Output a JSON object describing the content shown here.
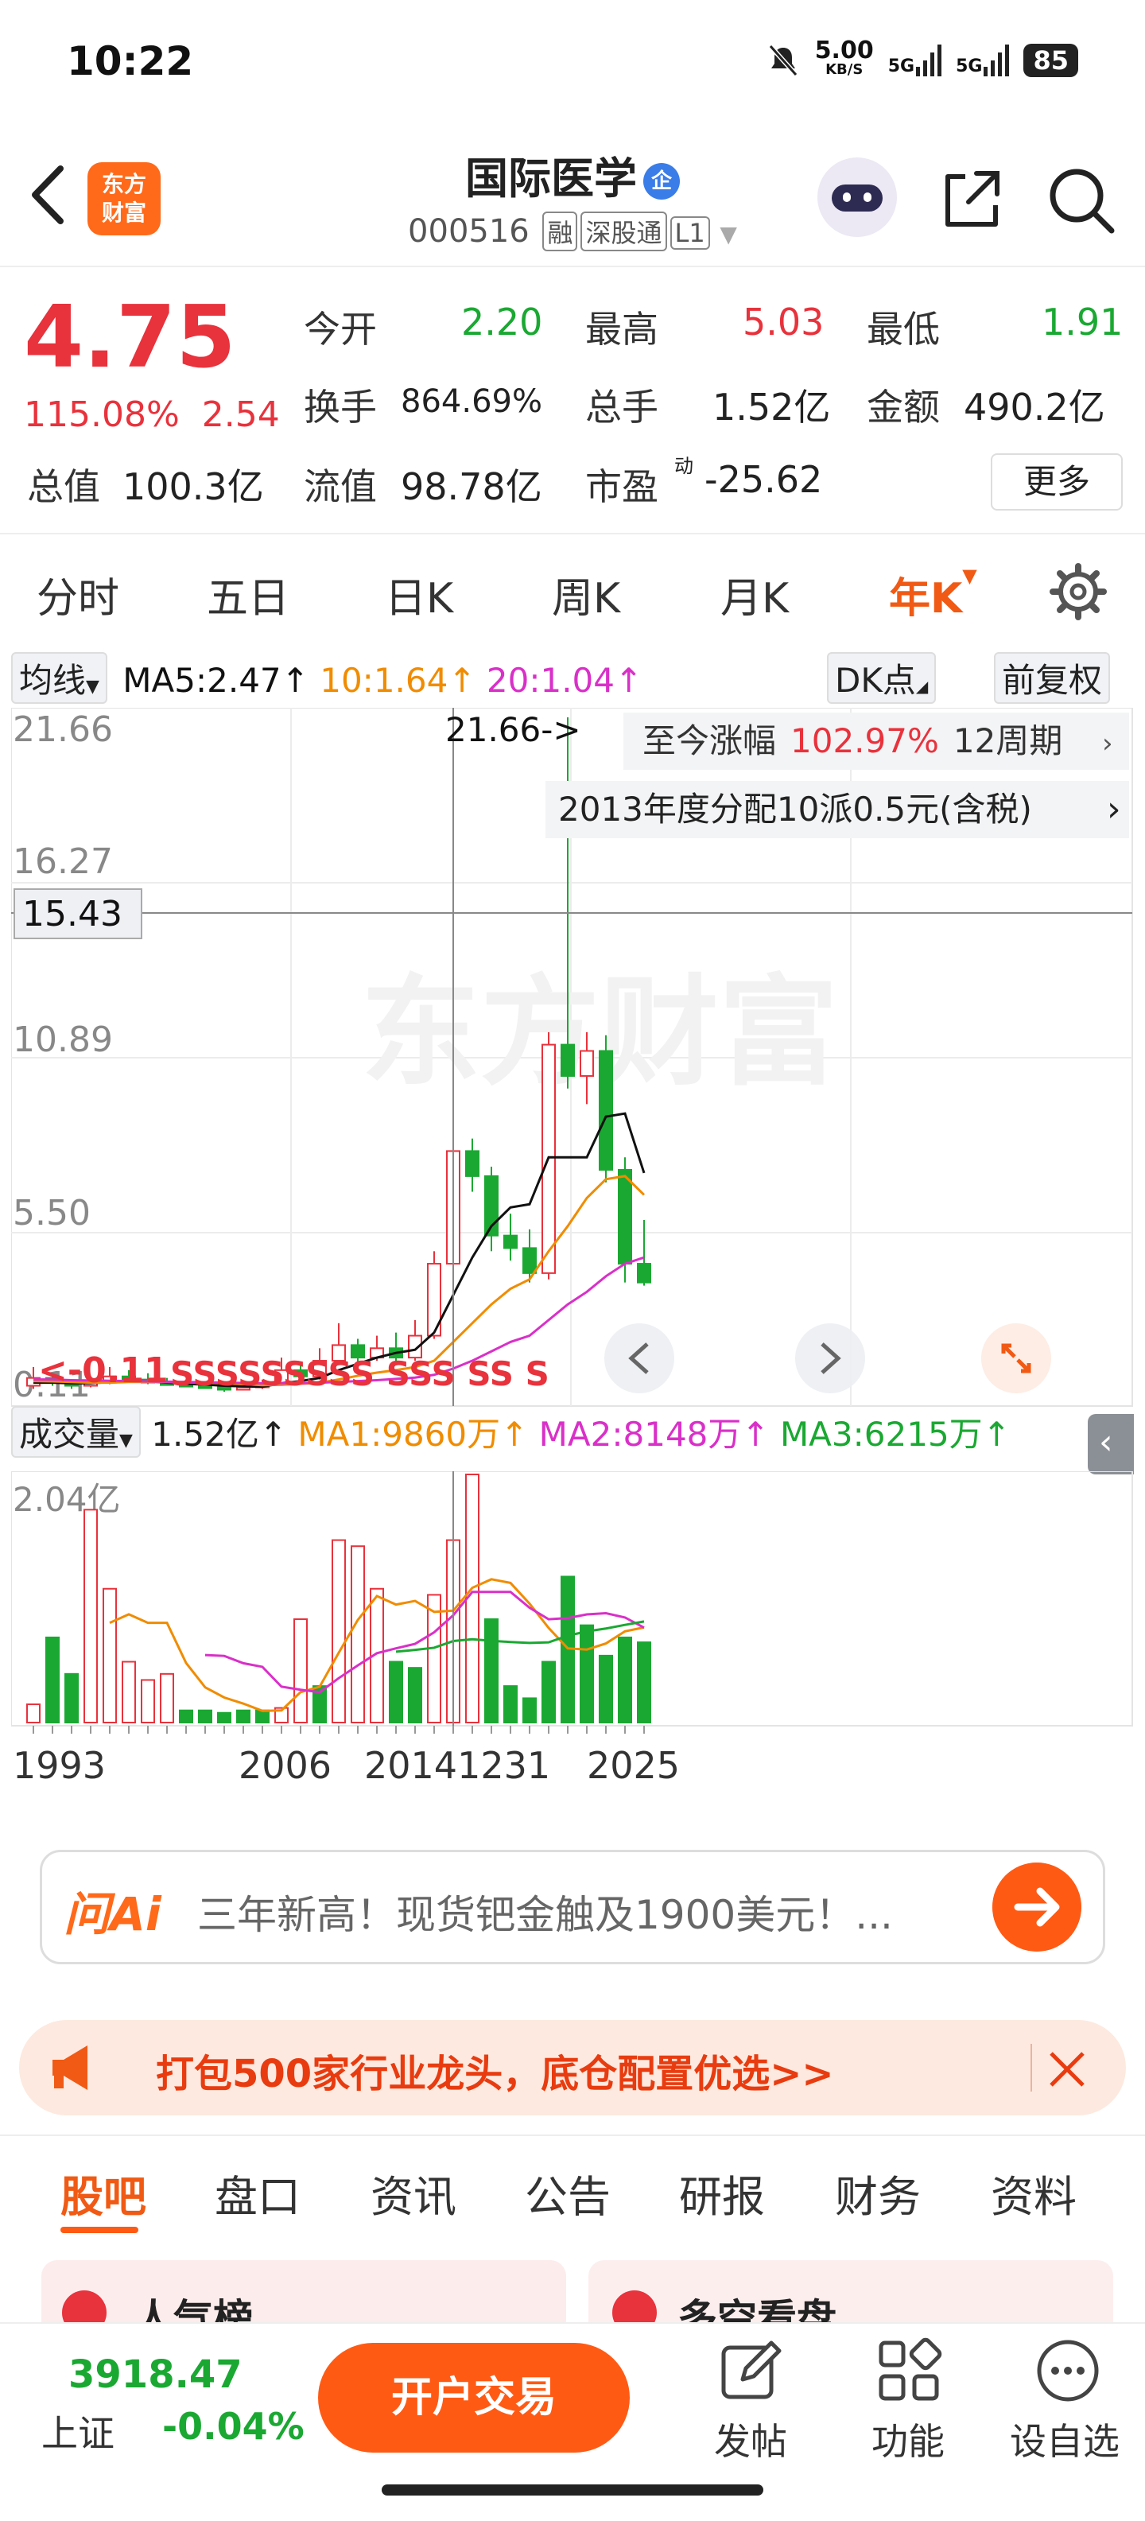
{
  "status_bar": {
    "time": "10:22",
    "net_speed": "5.00",
    "net_unit": "KB/S",
    "signal1": "5G",
    "signal2": "5G",
    "battery": "85"
  },
  "header": {
    "logo_text_line1": "东方",
    "logo_text_line2": "财富",
    "stock_name": "国际医学",
    "stock_badge": "企",
    "stock_code": "000516",
    "tags": [
      "融",
      "深股通",
      "L1"
    ]
  },
  "quote": {
    "price": "4.75",
    "change_pct": "115.08%",
    "change_amt": "2.54",
    "fields": {
      "open_label": "今开",
      "open": "2.20",
      "high_label": "最高",
      "high": "5.03",
      "low_label": "最低",
      "low": "1.91",
      "turnover_label": "换手",
      "turnover": "864.69%",
      "volume_label": "总手",
      "volume": "1.52亿",
      "amount_label": "金额",
      "amount": "490.2亿",
      "mcap_label": "总值",
      "mcap": "100.3亿",
      "float_label": "流值",
      "float": "98.78亿",
      "pe_label": "市盈",
      "pe_sup": "动",
      "pe": "-25.62"
    },
    "more_label": "更多"
  },
  "period_tabs": [
    "分时",
    "五日",
    "日K",
    "周K",
    "月K",
    "年K"
  ],
  "active_period": "年K",
  "chart_toolbar": {
    "ma_select": "均线",
    "ma5": "MA5:2.47↑",
    "ma10": "10:1.64↑",
    "ma20": "20:1.04↑",
    "dk_label": "DK点",
    "adjust_label": "前复权"
  },
  "chart_labels": {
    "y_ticks": [
      "21.66",
      "16.27",
      "10.89",
      "5.50",
      "0.11"
    ],
    "crosshair_price": "15.43",
    "high_marker": "21.66->",
    "low_marker": "<-0.11",
    "gain_prefix": "至今涨幅",
    "gain_value": "102.97%",
    "gain_period": "12周期",
    "dividend_note": "2013年度分配10派0.5元(含税)",
    "watermark": "东方财富",
    "signals": "SSSSSSSSS SSS SS S"
  },
  "volume_toolbar": {
    "select": "成交量",
    "vol": "1.52亿↑",
    "ma1": "MA1:9860万↑",
    "ma2": "MA2:8148万↑",
    "ma3": "MA3:6215万↑",
    "y_max": "2.04亿"
  },
  "x_axis": [
    "1993",
    "2006",
    "20141231",
    "2025"
  ],
  "colors": {
    "up": "#e8323c",
    "down": "#1aa832",
    "ma5": "#111111",
    "ma10": "#f08c00",
    "ma20": "#d930c8",
    "accent": "#ff5a14"
  },
  "chart_data": {
    "type": "candlestick",
    "period": "yearly",
    "x_range": [
      "1993",
      "2025"
    ],
    "ylim": [
      0.11,
      21.66
    ],
    "candles": [
      {
        "o": 0.3,
        "c": 0.55,
        "h": 0.9,
        "l": 0.2
      },
      {
        "o": 0.55,
        "c": 0.4,
        "h": 0.7,
        "l": 0.3
      },
      {
        "o": 0.4,
        "c": 0.3,
        "h": 0.5,
        "l": 0.2
      },
      {
        "o": 0.3,
        "c": 0.4,
        "h": 0.6,
        "l": 0.25
      },
      {
        "o": 0.4,
        "c": 0.6,
        "h": 0.9,
        "l": 0.35
      },
      {
        "o": 0.6,
        "c": 0.5,
        "h": 0.8,
        "l": 0.4
      },
      {
        "o": 0.5,
        "c": 0.4,
        "h": 0.7,
        "l": 0.35
      },
      {
        "o": 0.4,
        "c": 0.35,
        "h": 0.55,
        "l": 0.3
      },
      {
        "o": 0.35,
        "c": 0.3,
        "h": 0.45,
        "l": 0.25
      },
      {
        "o": 0.3,
        "c": 0.25,
        "h": 0.4,
        "l": 0.2
      },
      {
        "o": 0.25,
        "c": 0.2,
        "h": 0.35,
        "l": 0.11
      },
      {
        "o": 0.2,
        "c": 0.25,
        "h": 0.35,
        "l": 0.15
      },
      {
        "o": 0.25,
        "c": 0.35,
        "h": 0.5,
        "l": 0.2
      },
      {
        "o": 0.35,
        "c": 0.8,
        "h": 1.2,
        "l": 0.3
      },
      {
        "o": 0.8,
        "c": 0.6,
        "h": 1.0,
        "l": 0.5
      },
      {
        "o": 0.6,
        "c": 1.1,
        "h": 1.5,
        "l": 0.5
      },
      {
        "o": 1.1,
        "c": 1.6,
        "h": 2.3,
        "l": 1.0
      },
      {
        "o": 1.6,
        "c": 1.2,
        "h": 1.8,
        "l": 1.0
      },
      {
        "o": 1.2,
        "c": 1.5,
        "h": 1.9,
        "l": 1.1
      },
      {
        "o": 1.5,
        "c": 1.2,
        "h": 2.0,
        "l": 1.0
      },
      {
        "o": 1.2,
        "c": 1.9,
        "h": 2.4,
        "l": 1.1
      },
      {
        "o": 1.9,
        "c": 4.2,
        "h": 4.6,
        "l": 1.8
      },
      {
        "o": 4.2,
        "c": 7.8,
        "h": 13.2,
        "l": 3.9
      },
      {
        "o": 7.8,
        "c": 7.0,
        "h": 8.2,
        "l": 6.5
      },
      {
        "o": 7.0,
        "c": 5.1,
        "h": 7.3,
        "l": 4.6
      },
      {
        "o": 5.1,
        "c": 4.7,
        "h": 5.8,
        "l": 4.3
      },
      {
        "o": 4.7,
        "c": 3.9,
        "h": 5.3,
        "l": 3.6
      },
      {
        "o": 3.9,
        "c": 11.2,
        "h": 11.6,
        "l": 3.7
      },
      {
        "o": 11.2,
        "c": 10.2,
        "h": 21.66,
        "l": 9.8
      },
      {
        "o": 10.2,
        "c": 11.0,
        "h": 11.6,
        "l": 9.3
      },
      {
        "o": 11.0,
        "c": 7.2,
        "h": 11.5,
        "l": 6.8
      },
      {
        "o": 7.2,
        "c": 4.2,
        "h": 7.6,
        "l": 3.6
      },
      {
        "o": 4.2,
        "c": 3.6,
        "h": 5.6,
        "l": 3.5
      }
    ],
    "ma_lines": {
      "MA5": [
        0.4,
        0.4,
        0.38,
        0.38,
        0.42,
        0.45,
        0.44,
        0.4,
        0.36,
        0.34,
        0.3,
        0.28,
        0.27,
        0.38,
        0.45,
        0.55,
        0.8,
        1.0,
        1.2,
        1.35,
        1.45,
        2.0,
        3.2,
        4.4,
        5.4,
        6.0,
        6.1,
        7.6,
        7.6,
        7.6,
        8.9,
        9.0,
        7.1
      ],
      "MA10": [
        0.45,
        0.44,
        0.42,
        0.4,
        0.4,
        0.42,
        0.42,
        0.42,
        0.41,
        0.4,
        0.38,
        0.35,
        0.32,
        0.33,
        0.36,
        0.4,
        0.5,
        0.62,
        0.72,
        0.8,
        0.9,
        1.1,
        1.7,
        2.3,
        2.9,
        3.4,
        3.7,
        4.6,
        5.4,
        6.3,
        6.9,
        7.0,
        6.4
      ],
      "MA20": [
        0.5,
        0.5,
        0.48,
        0.47,
        0.46,
        0.45,
        0.44,
        0.43,
        0.42,
        0.41,
        0.4,
        0.39,
        0.38,
        0.38,
        0.38,
        0.4,
        0.42,
        0.45,
        0.48,
        0.52,
        0.56,
        0.65,
        0.85,
        1.1,
        1.4,
        1.7,
        1.9,
        2.4,
        2.9,
        3.3,
        3.8,
        4.2,
        4.4
      ]
    },
    "volume": {
      "unit": "亿",
      "ymax": 2.04,
      "values": [
        0.15,
        0.7,
        0.4,
        1.75,
        1.1,
        0.5,
        0.35,
        0.4,
        0.1,
        0.1,
        0.08,
        0.1,
        0.1,
        0.12,
        0.85,
        0.3,
        1.5,
        1.45,
        1.1,
        0.5,
        0.45,
        1.05,
        1.5,
        2.04,
        0.85,
        0.3,
        0.2,
        0.5,
        1.2,
        0.8,
        0.55,
        0.7,
        0.66
      ],
      "up": [
        1,
        0,
        0,
        1,
        1,
        1,
        1,
        1,
        0,
        0,
        0,
        0,
        0,
        1,
        1,
        0,
        1,
        1,
        1,
        0,
        0,
        1,
        1,
        1,
        0,
        0,
        0,
        0,
        0,
        0,
        0,
        0,
        0
      ]
    }
  },
  "ai_search": {
    "logo": "问Ai",
    "text": "三年新高！现货钯金触及1900美元！..."
  },
  "promo": {
    "text": "打包500家行业龙头，底仓配置优选>>"
  },
  "content_tabs": [
    "股吧",
    "盘口",
    "资讯",
    "公告",
    "研报",
    "财务",
    "资料"
  ],
  "cards": {
    "left": "人气榜",
    "right": "多空看盘"
  },
  "bottom_bar": {
    "index_value": "3918.47",
    "index_name": "上证",
    "index_change": "-0.04%",
    "trade_button": "开户交易",
    "actions": [
      "发帖",
      "功能",
      "设自选"
    ]
  }
}
